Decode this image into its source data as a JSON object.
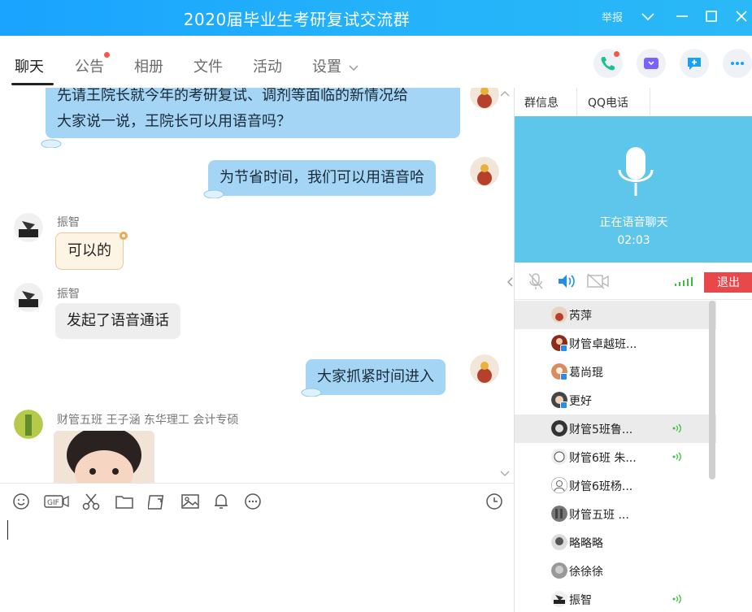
{
  "window": {
    "title": "2020届毕业生考研复试交流群",
    "report_label": "举报"
  },
  "tabs": [
    "聊天",
    "公告",
    "相册",
    "文件",
    "活动",
    "设置"
  ],
  "messages": [
    {
      "side": "right",
      "text_lines": [
        "先请王院长就今年的考研复试、调剂等面临的新情况给",
        "大家说一说，王院长可以用语音吗？"
      ]
    },
    {
      "side": "right",
      "text": "为节省时间，我们可以用语音哈"
    },
    {
      "side": "left",
      "sender": "振智",
      "text": "可以的"
    },
    {
      "side": "left",
      "sender": "振智",
      "text": "发起了语音通话"
    },
    {
      "side": "right",
      "text": "大家抓紧时间进入"
    },
    {
      "side": "left",
      "sender": "财管五班 王子涵 东华理工  会计专硕"
    }
  ],
  "right_panel": {
    "tabs": [
      "群信息",
      "QQ电话"
    ],
    "voice_status": "正在语音聊天",
    "voice_time": "02:03",
    "exit_label": "退出"
  },
  "members": [
    {
      "name": "芮萍",
      "speaking": false
    },
    {
      "name": "财管卓越班...",
      "speaking": false
    },
    {
      "name": "葛尚琨",
      "speaking": false
    },
    {
      "name": "更好",
      "speaking": false
    },
    {
      "name": "财管5班鲁...",
      "speaking": true
    },
    {
      "name": "财管6班 朱...",
      "speaking": true
    },
    {
      "name": "财管6班杨...",
      "speaking": false
    },
    {
      "name": "财管五班 ...",
      "speaking": false
    },
    {
      "name": "略略略",
      "speaking": false
    },
    {
      "name": "徐徐徐",
      "speaking": false
    },
    {
      "name": "振智",
      "speaking": true
    }
  ],
  "colors": {
    "title_bar": "#1aa3ff",
    "voice_panel": "#5ec6ea",
    "bubble_blue": "#a4d5f5",
    "exit_button": "#e8484a",
    "notification_dot": "#f5574b"
  }
}
